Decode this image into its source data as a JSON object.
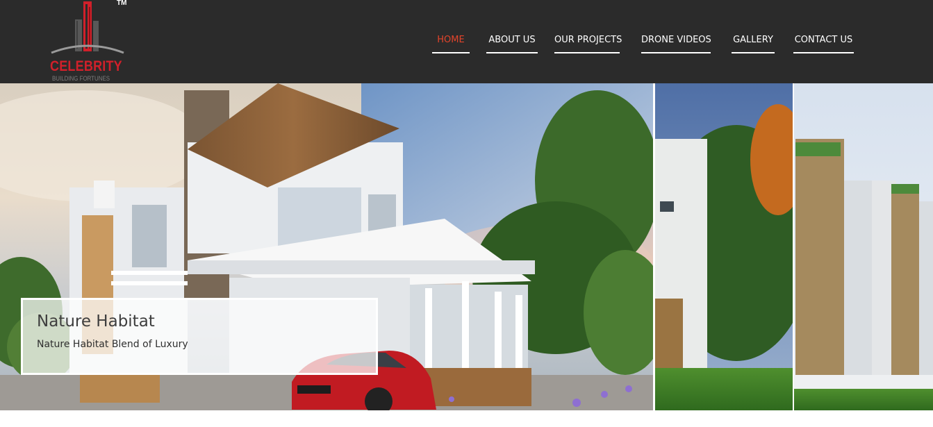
{
  "brand": {
    "name": "CELEBRITY",
    "tagline": "BUILDING FORTUNES",
    "trademark": "TM",
    "color": "#d1202a"
  },
  "nav": {
    "items": [
      {
        "label": "HOME",
        "active": true
      },
      {
        "label": "ABOUT US",
        "active": false
      },
      {
        "label": "OUR PROJECTS",
        "active": false
      },
      {
        "label": "DRONE VIDEOS",
        "active": false
      },
      {
        "label": "GALLERY",
        "active": false
      },
      {
        "label": "CONTACT US",
        "active": false
      }
    ],
    "active_color": "#e4442b"
  },
  "hero": {
    "slide": {
      "title": "Nature Habitat",
      "subtitle": "Nature Habitat Blend of Luxury"
    }
  },
  "colors": {
    "header_bg": "#2b2b2b",
    "nav_text": "#ffffff"
  }
}
